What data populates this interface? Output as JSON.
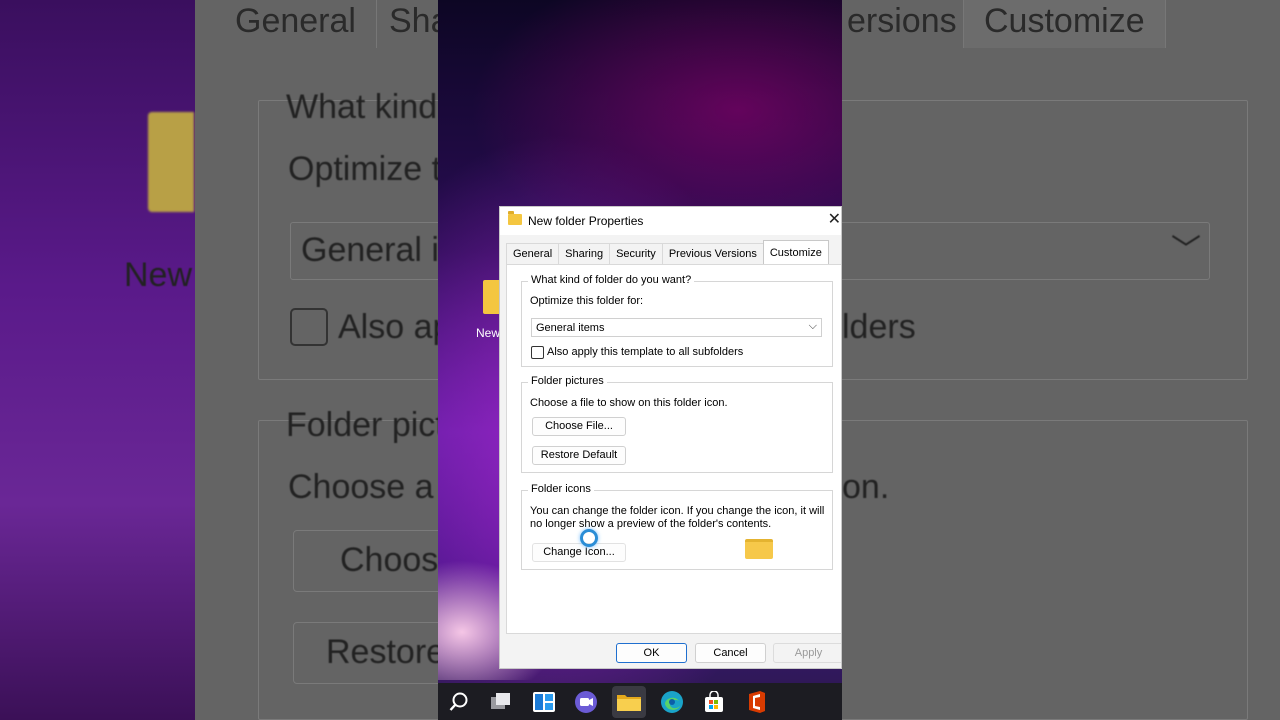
{
  "dialog": {
    "title": "New folder Properties",
    "tabs": [
      {
        "label": "General"
      },
      {
        "label": "Sharing"
      },
      {
        "label": "Security"
      },
      {
        "label": "Previous Versions"
      },
      {
        "label": "Customize",
        "active": true
      }
    ],
    "folder_type": {
      "heading": "What kind of folder do you want?",
      "optimize_label": "Optimize this folder for:",
      "selected": "General items",
      "apply_subfolders_label": "Also apply this template to all subfolders",
      "apply_subfolders_checked": false
    },
    "folder_pictures": {
      "heading": "Folder pictures",
      "description": "Choose a file to show on this folder icon.",
      "choose_file_button": "Choose File...",
      "restore_default_button": "Restore Default"
    },
    "folder_icons": {
      "heading": "Folder icons",
      "description_line1": "You can change the folder icon. If you change the icon, it will",
      "description_line2": "no longer show a preview of the folder's contents.",
      "change_icon_button": "Change Icon..."
    },
    "footer": {
      "ok": "OK",
      "cancel": "Cancel",
      "apply": "Apply"
    }
  },
  "desktop": {
    "icon_label": "New"
  },
  "background": {
    "tab_general": "General",
    "tab_sharing": "Sha",
    "tab_versions": "ersions",
    "tab_customize": "Customize",
    "heading": "What kind",
    "optimize": "Optimize th",
    "select_value": "General it",
    "also_apply": "Also ap",
    "subfolders": "lders",
    "folder_pictures": "Folder pictu",
    "choose": "Choose a f",
    "choose_tail": "on.",
    "choose_button": "Choose",
    "restore_button": "Restore",
    "desktop_label": "New"
  },
  "taskbar": {
    "items": [
      "search-icon",
      "task-view-icon",
      "widgets-icon",
      "chat-icon",
      "file-explorer-icon",
      "edge-icon",
      "store-icon",
      "office-icon"
    ]
  },
  "colors": {
    "accent": "#1f6fcf",
    "folder_yellow": "#f4c640"
  }
}
